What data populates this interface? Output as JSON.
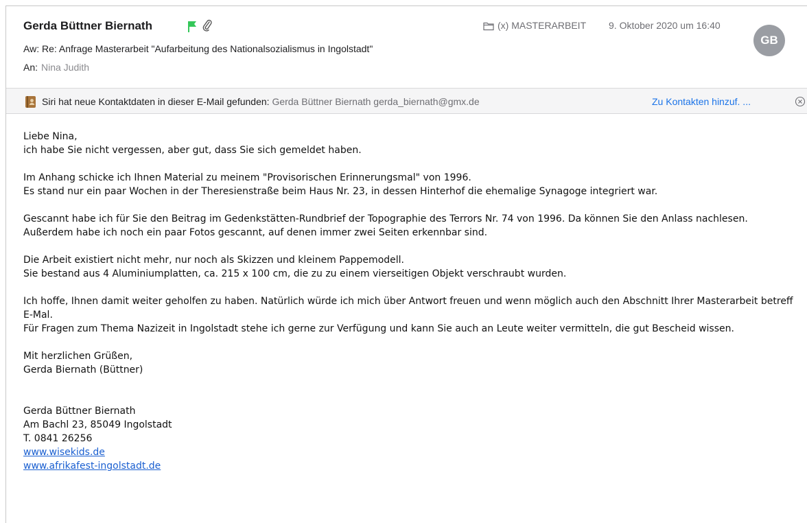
{
  "header": {
    "sender": "Gerda Büttner Biernath",
    "flag_color": "#34c759",
    "folder_label": "(x) MASTERARBEIT",
    "date": "9. Oktober 2020 um 16:40",
    "avatar_initials": "GB",
    "subject": "Aw: Re: Anfrage Masterarbeit \"Aufarbeitung des Nationalsozialismus in Ingolstadt\"",
    "to_label": "An:",
    "to_value": "Nina Judith"
  },
  "siri": {
    "text": "Siri hat neue Kontaktdaten in dieser E-Mail gefunden:",
    "contact": "Gerda Büttner Biernath gerda_biernath@gmx.de",
    "add_label": "Zu Kontakten hinzuf. ..."
  },
  "body": {
    "greeting": "Liebe Nina,",
    "p1": "ich habe Sie nicht vergessen, aber gut, dass Sie sich gemeldet haben.",
    "p2a": "Im Anhang schicke ich Ihnen Material zu meinem \"Provisorischen Erinnerungsmal\" von 1996.",
    "p2b": "Es stand nur ein paar Wochen in der Theresienstraße beim Haus Nr. 23, in dessen Hinterhof die ehemalige Synagoge integriert war.",
    "p3a": "Gescannt habe ich für Sie den Beitrag im Gedenkstätten-Rundbrief der Topographie des Terrors Nr. 74 von 1996. Da können Sie den Anlass nachlesen.",
    "p3b": "Außerdem habe ich noch ein paar Fotos gescannt, auf denen immer zwei Seiten erkennbar sind.",
    "p4a": "Die Arbeit existiert nicht mehr, nur noch als Skizzen und kleinem Pappemodell.",
    "p4b": "Sie bestand aus 4 Aluminiumplatten, ca. 215 x 100 cm, die zu zu einem vierseitigen Objekt verschraubt wurden.",
    "p5a": "Ich hoffe, Ihnen damit weiter geholfen zu haben. Natürlich würde ich mich über Antwort freuen und wenn möglich auch den Abschnitt Ihrer Masterarbeit betreff E-Mal.",
    "p5b": "Für Fragen zum Thema Nazizeit in Ingolstadt stehe ich gerne zur Verfügung und kann Sie auch an Leute weiter vermitteln, die gut Bescheid wissen.",
    "closing": "Mit herzlichen Grüßen,",
    "signoff": "Gerda Biernath (Büttner)",
    "sig_name": "Gerda Büttner Biernath",
    "sig_address": "Am Bachl 23, 85049 Ingolstadt",
    "sig_phone": "T. 0841 26256",
    "link1": "www.wisekids.de",
    "link2": "www.afrikafest-ingolstadt.de"
  }
}
